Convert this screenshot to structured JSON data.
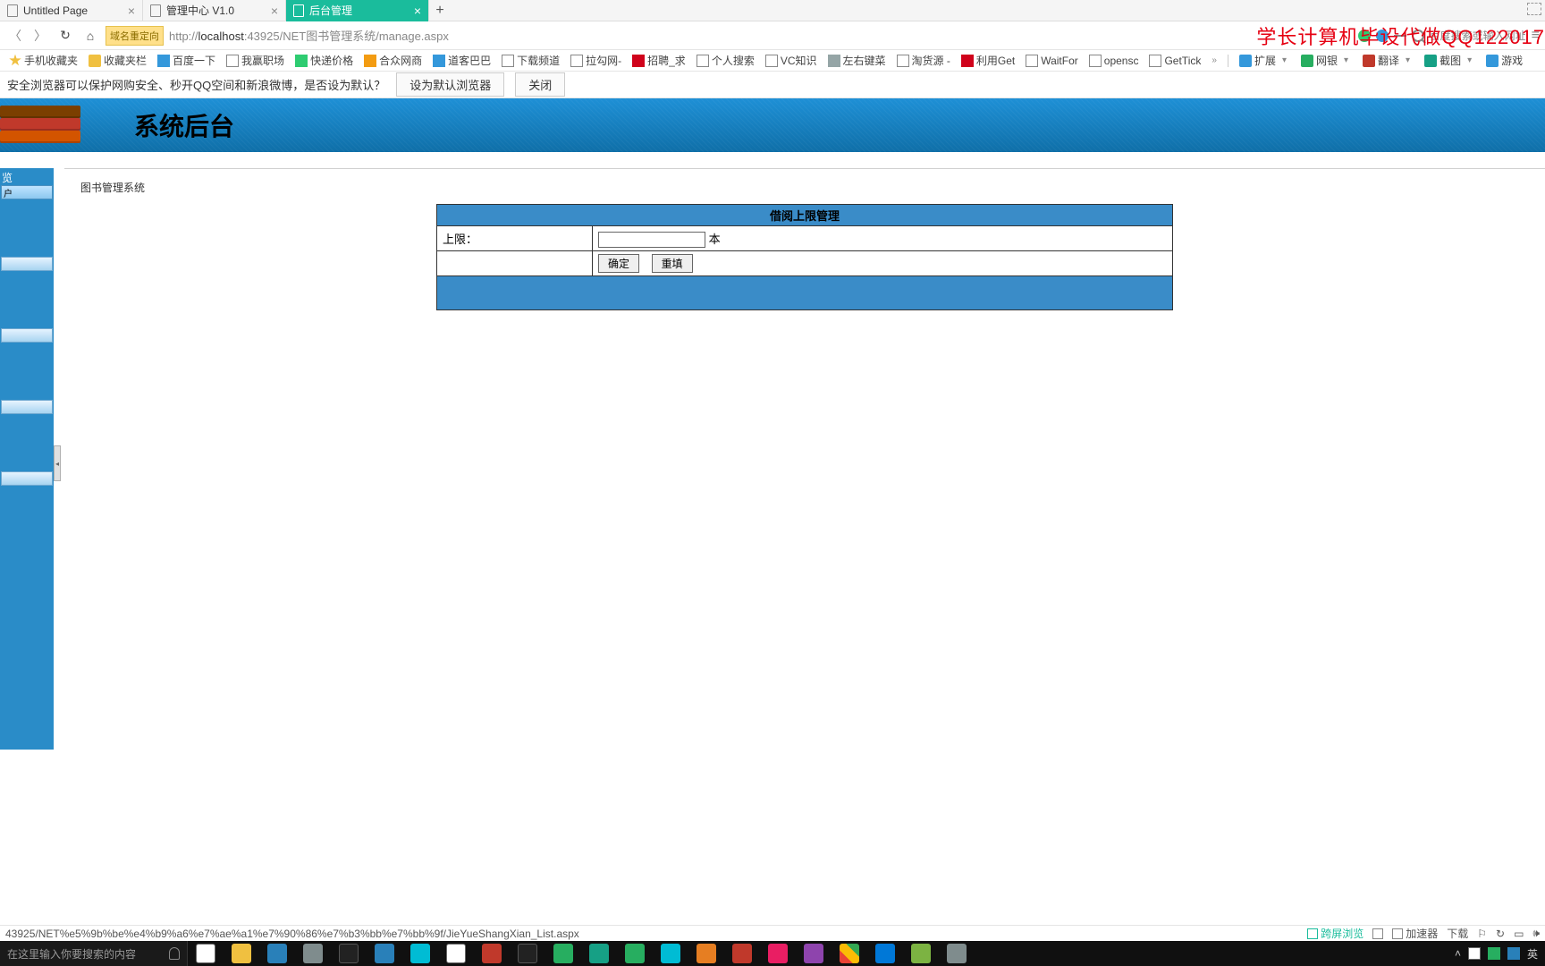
{
  "tabs": [
    {
      "label": "Untitled Page",
      "active": false
    },
    {
      "label": "管理中心 V1.0",
      "active": false
    },
    {
      "label": "后台管理",
      "active": true
    }
  ],
  "addr": {
    "redirect_badge": "域名重定向",
    "url_prefix": "http://",
    "url_host": "localhost",
    "url_rest": ":43925/NET图书管理系统/manage.aspx",
    "search_hint": "百度搜索或输入网址"
  },
  "watermark": "学长计算机毕设代做QQ122017",
  "bookmarks": [
    {
      "icon": "star",
      "label": "手机收藏夹"
    },
    {
      "icon": "folder",
      "label": "收藏夹栏"
    },
    {
      "icon": "blue",
      "label": "百度一下"
    },
    {
      "icon": "doc",
      "label": "我赢职场"
    },
    {
      "icon": "green",
      "label": "快递价格"
    },
    {
      "icon": "orange",
      "label": "合众网商"
    },
    {
      "icon": "blue",
      "label": "道客巴巴"
    },
    {
      "icon": "doc",
      "label": "下载频道"
    },
    {
      "icon": "doc",
      "label": "拉勾网-"
    },
    {
      "icon": "red",
      "label": "招聘_求"
    },
    {
      "icon": "doc",
      "label": "个人搜索"
    },
    {
      "icon": "doc",
      "label": "VC知识"
    },
    {
      "icon": "gray",
      "label": "左右键菜"
    },
    {
      "icon": "doc",
      "label": "淘货源 -"
    },
    {
      "icon": "red",
      "label": "利用Get"
    },
    {
      "icon": "doc",
      "label": "WaitFor"
    },
    {
      "icon": "doc",
      "label": "opensc"
    },
    {
      "icon": "doc",
      "label": "GetTick"
    }
  ],
  "bm_ext": [
    {
      "cls": "",
      "label": "扩展"
    },
    {
      "cls": "green",
      "label": "网银"
    },
    {
      "cls": "red",
      "label": "翻译"
    },
    {
      "cls": "teal",
      "label": "截图"
    },
    {
      "cls": "",
      "label": "游戏"
    }
  ],
  "notice": {
    "text": "安全浏览器可以保护网购安全、秒开QQ空间和新浪微博，是否设为默认？",
    "btn_set": "设为默认浏览器",
    "btn_close": "关闭"
  },
  "banner_title": "系统后台",
  "sidebar": {
    "head": "览",
    "top_item": "户"
  },
  "content": {
    "breadcrumb": "图书管理系统",
    "form_title": "借阅上限管理",
    "label_limit": "上限：",
    "unit": "本",
    "btn_ok": "确定",
    "btn_reset": "重填"
  },
  "status": {
    "url": "43925/NET%e5%9b%be%e4%b9%a6%e7%ae%a1%e7%90%86%e7%b3%bb%e7%bb%9f/JieYueShangXian_List.aspx",
    "right": [
      "跨屏浏览",
      "",
      "加速器",
      "下载"
    ]
  },
  "taskbar": {
    "search_placeholder": "在这里输入你要搜索的内容",
    "tray": [
      "英"
    ]
  }
}
